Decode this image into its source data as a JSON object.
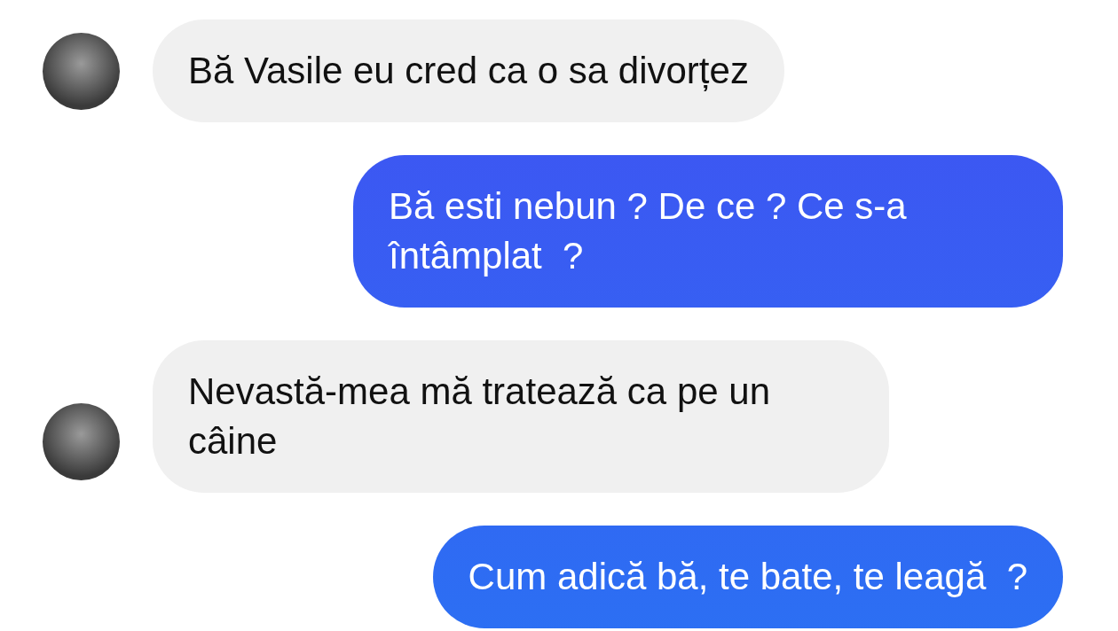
{
  "messages": [
    {
      "kind": "received",
      "text": "Bă Vasile eu cred ca o sa divorțez"
    },
    {
      "kind": "sent",
      "text": "Bă esti nebun ? De ce ? Ce s-a întâmplat  ?"
    },
    {
      "kind": "received",
      "text": "Nevastă-mea mă tratează ca pe un câine"
    },
    {
      "kind": "sent",
      "text": "Cum adică bă, te bate, te leagă  ?"
    }
  ]
}
